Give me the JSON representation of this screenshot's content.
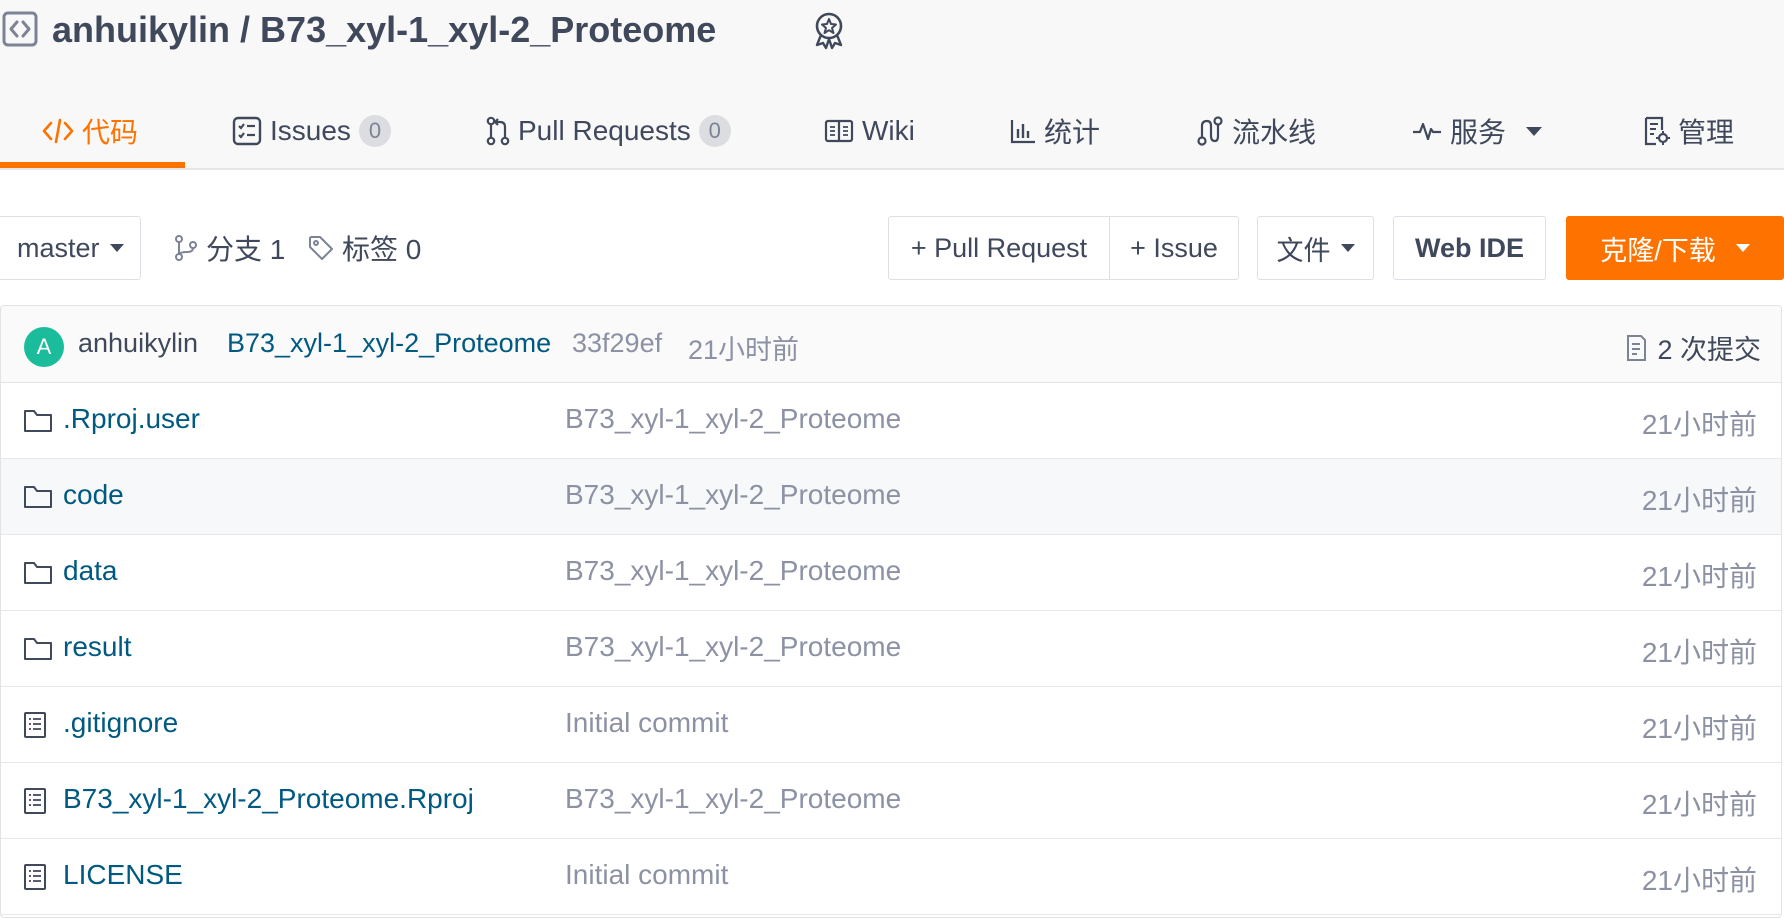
{
  "repo": {
    "owner": "anhuikylin",
    "separator": " / ",
    "name": "B73_xyl-1_xyl-2_Proteome"
  },
  "tabs": [
    {
      "label": "代码",
      "icon": "code-icon",
      "active": true
    },
    {
      "label": "Issues",
      "count": "0",
      "icon": "issues-icon"
    },
    {
      "label": "Pull Requests",
      "count": "0",
      "icon": "pull-request-icon"
    },
    {
      "label": "Wiki",
      "icon": "book-icon"
    },
    {
      "label": "统计",
      "icon": "bar-chart-icon"
    },
    {
      "label": "流水线",
      "icon": "pipeline-icon"
    },
    {
      "label": "服务",
      "icon": "pulse-icon",
      "dropdown": true
    },
    {
      "label": "管理",
      "icon": "settings-doc-icon"
    }
  ],
  "toolbar": {
    "branch": "master",
    "branches_label": "分支 1",
    "tags_label": "标签 0",
    "pr_button": "+ Pull Request",
    "issue_button": "+ Issue",
    "file_button": "文件",
    "webide_button": "Web IDE",
    "clone_button": "克隆/下载"
  },
  "commit": {
    "avatar_letter": "A",
    "author": "anhuikylin",
    "message": "B73_xyl-1_xyl-2_Proteome",
    "sha": "33f29ef",
    "time": "21小时前",
    "count_label": "2 次提交"
  },
  "files": [
    {
      "type": "folder",
      "name": ".Rproj.user",
      "message": "B73_xyl-1_xyl-2_Proteome",
      "time": "21小时前"
    },
    {
      "type": "folder",
      "name": "code",
      "message": "B73_xyl-1_xyl-2_Proteome",
      "time": "21小时前"
    },
    {
      "type": "folder",
      "name": "data",
      "message": "B73_xyl-1_xyl-2_Proteome",
      "time": "21小时前"
    },
    {
      "type": "folder",
      "name": "result",
      "message": "B73_xyl-1_xyl-2_Proteome",
      "time": "21小时前"
    },
    {
      "type": "file",
      "name": ".gitignore",
      "message": "Initial commit",
      "time": "21小时前"
    },
    {
      "type": "file",
      "name": "B73_xyl-1_xyl-2_Proteome.Rproj",
      "message": "B73_xyl-1_xyl-2_Proteome",
      "time": "21小时前"
    },
    {
      "type": "file",
      "name": "LICENSE",
      "message": "Initial commit",
      "time": "21小时前"
    }
  ],
  "colors": {
    "accent": "#fe7300",
    "link": "#005980",
    "muted": "#8c92a4",
    "avatar": "#1abc9c"
  }
}
